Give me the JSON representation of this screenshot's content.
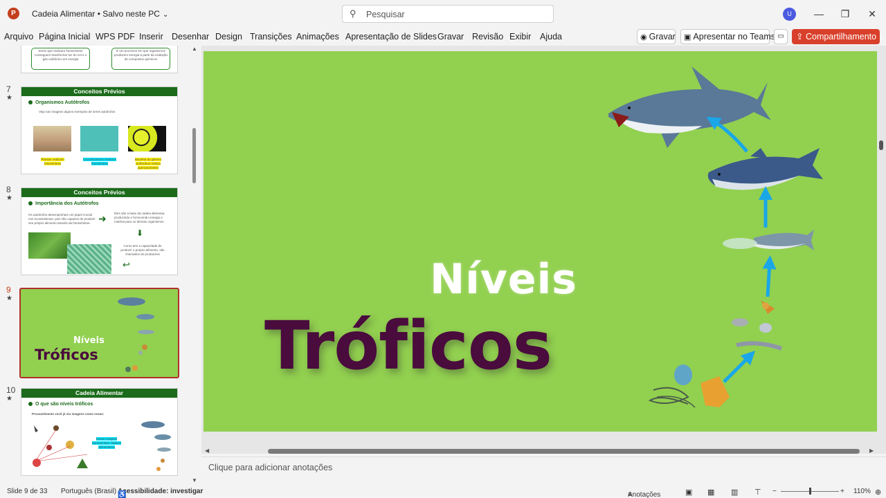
{
  "titlebar": {
    "app_logo": "P",
    "doc_title": "Cadeia Alimentar • Salvo neste PC",
    "search_placeholder": "Pesquisar",
    "avatar_initial": "U"
  },
  "ribbon": {
    "tabs": [
      "Arquivo",
      "Página Inicial",
      "WPS PDF",
      "Inserir",
      "Desenhar",
      "Design",
      "Transições",
      "Animações",
      "Apresentação de Slides",
      "Gravar",
      "Revisão",
      "Exibir",
      "Ajuda"
    ],
    "record_label": "Gravar",
    "teams_label": "Apresentar no Teams",
    "share_label": "Compartilhamento"
  },
  "thumbnails": {
    "slide6": {
      "text_left": "Seres que realizam fotossíntese conseguem transformar luz do sol e o gás carbônico em energia",
      "text_right": "É um processo em que organismos produzem energia a partir da oxidação de compostos químicos"
    },
    "slide7": {
      "number": "7",
      "header": "Conceitos Prévios",
      "subtitle": "Organismos Autótrofos",
      "intro": "Veja nas imagens alguns exemplos de seres autótrofos",
      "caption1": "Plantas realizam fotossíntese",
      "caption2": "Cianobactérias realizam fotossíntese",
      "caption3": "Bactéria do gênero Sulfolobus realiza quimiossíntese"
    },
    "slide8": {
      "number": "8",
      "header": "Conceitos Prévios",
      "subtitle": "Importância dos Autótrofos",
      "text1": "Os autótrofos desempenham um papel crucial nos ecossistemas, pois são capazes de produzir seu próprio alimento através da fotossíntese.",
      "text2": "Eles são a base da cadeia alimentar, produzindo e fornecendo energia e matéria para os demais organismos.",
      "text3": "Como tem a capacidade de produzir o próprio alimento, são chamados de produtores"
    },
    "slide9": {
      "number": "9",
      "title_top": "Níveis",
      "title_bottom": "Tróficos"
    },
    "slide10": {
      "number": "10",
      "header": "Cadeia Alimentar",
      "subtitle": "O que são níveis tróficos",
      "intro": "Provavelmente você já viu imagens como essas:",
      "caption": "Essas imagens representam cadeias alimentares"
    }
  },
  "slide": {
    "title_top": "Níveis",
    "title_bottom": "Tróficos",
    "background_color": "#92d050",
    "title_bottom_color": "#4a0b3d"
  },
  "notes": {
    "placeholder": "Clique para adicionar anotações"
  },
  "status": {
    "slide_info": "Slide 9 de 33",
    "language": "Português (Brasil)",
    "accessibility": "Acessibilidade: investigar",
    "notes_label": "Anotações",
    "zoom": "110%"
  }
}
